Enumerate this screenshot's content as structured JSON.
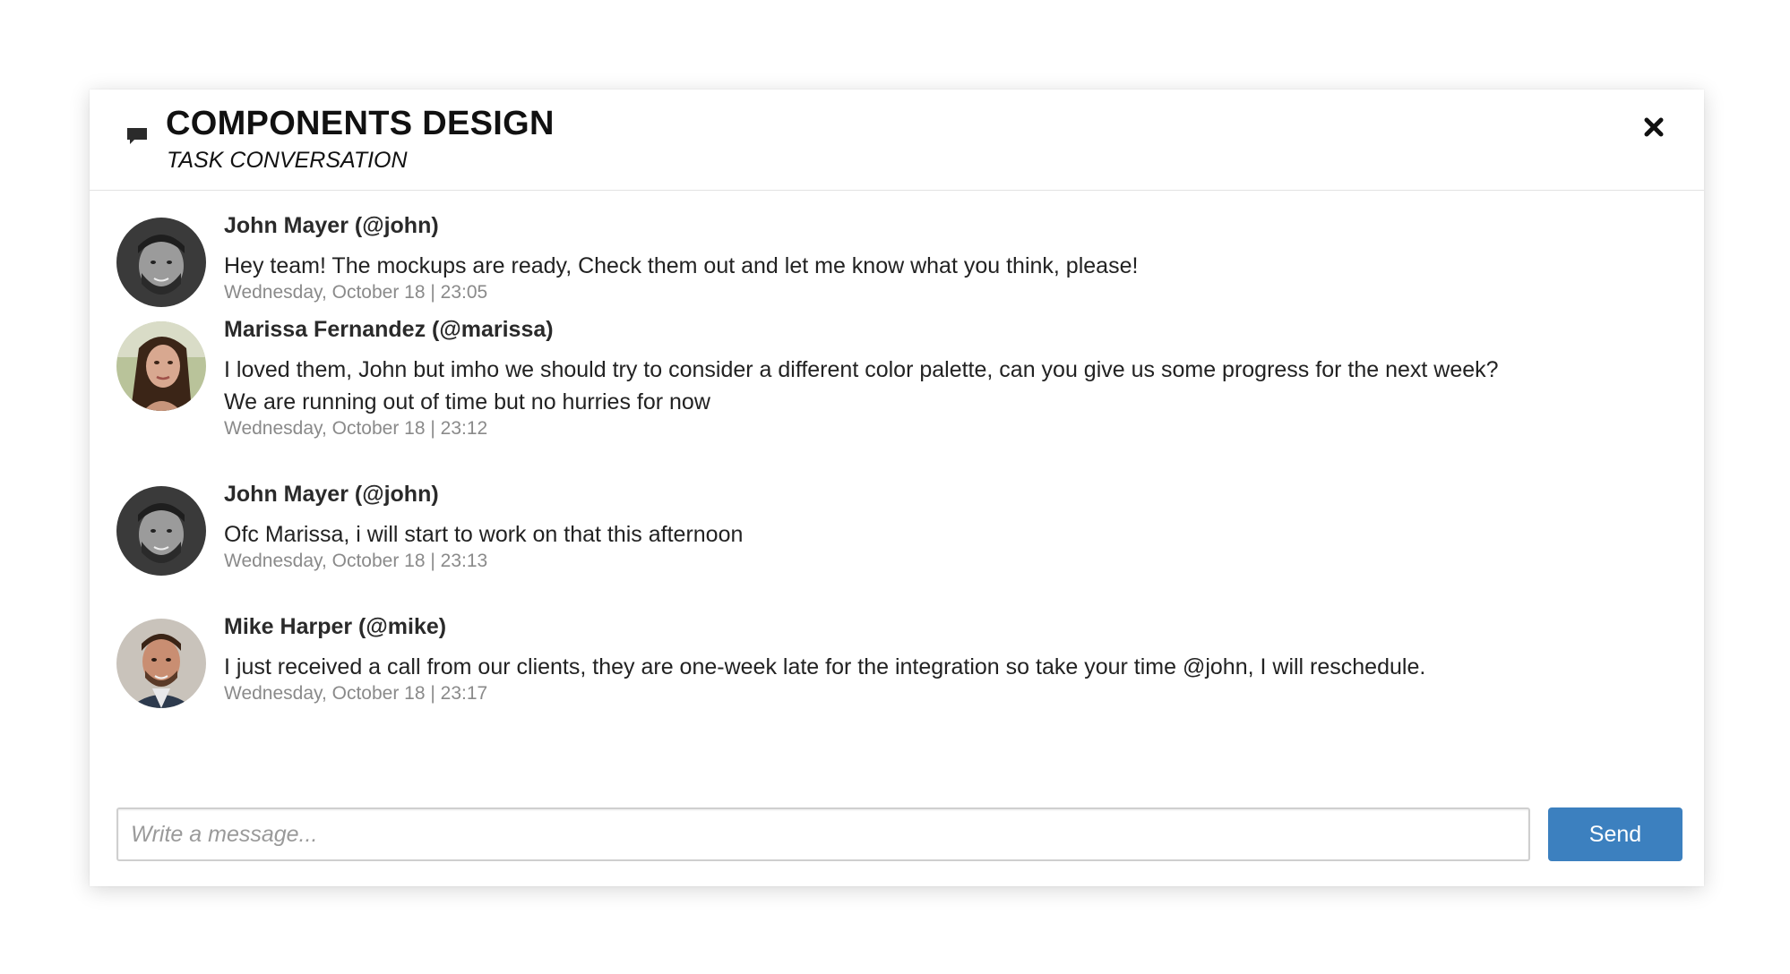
{
  "header": {
    "title": "COMPONENTS DESIGN",
    "subtitle": "TASK CONVERSATION",
    "icon": "chat-bubble-icon",
    "close_icon": "close-icon"
  },
  "messages": [
    {
      "author": "John Mayer (@john)",
      "lines": [
        "Hey team! The mockups are ready, Check them out and let me know what you think, please!"
      ],
      "time": "Wednesday, October 18 | 23:05",
      "avatar": "avatar-john-mayer"
    },
    {
      "author": "Marissa Fernandez (@marissa)",
      "lines": [
        "I loved them, John but imho we should try to consider a different color palette, can you give us some progress for the next week?",
        "We are running out of time but no hurries for now"
      ],
      "time": "Wednesday, October 18 | 23:12",
      "avatar": "avatar-marissa-fernandez"
    },
    {
      "author": "John Mayer (@john)",
      "lines": [
        "Ofc Marissa, i will start to work on that this afternoon"
      ],
      "time": "Wednesday, October 18 | 23:13",
      "avatar": "avatar-john-mayer"
    },
    {
      "author": "Mike Harper (@mike)",
      "lines": [
        "I just received a call from our clients, they are one-week late for the integration so take your time @john, I will reschedule."
      ],
      "time": "Wednesday, October 18 | 23:17",
      "avatar": "avatar-mike-harper"
    }
  ],
  "composer": {
    "placeholder": "Write a message...",
    "value": "",
    "send_label": "Send"
  },
  "colors": {
    "send_button": "#3c80bf",
    "timestamp": "#8a8a8a",
    "divider": "#e2e2e2"
  }
}
